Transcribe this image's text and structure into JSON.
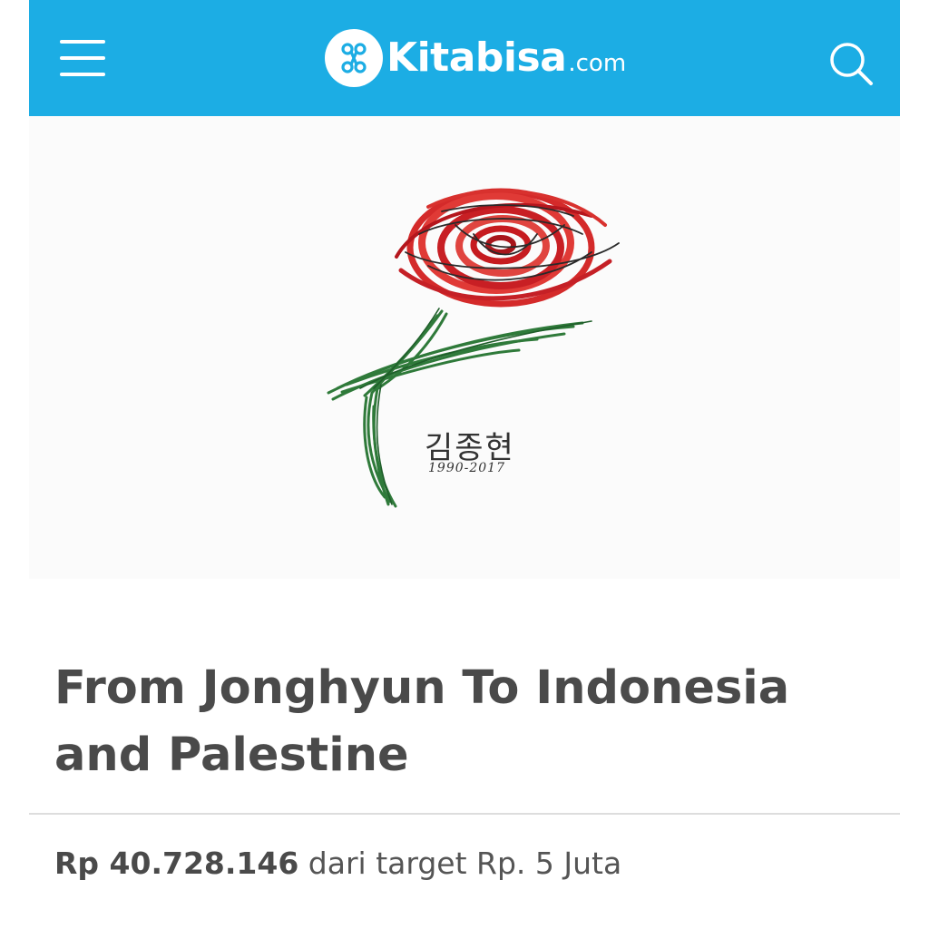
{
  "header": {
    "brand_name": "Kitabisa",
    "brand_tld": ".com",
    "menu_icon": "hamburger-menu-icon",
    "search_icon": "search-icon",
    "logo_icon": "kitabisa-logo-icon",
    "background_color": "#1cade4"
  },
  "campaign": {
    "image": {
      "subject": "red rose illustration",
      "name_text": "김종현",
      "years_text": "1990-2017"
    },
    "title": "From Jonghyun To Indonesia and Palestine",
    "amount": "Rp 40.728.146",
    "target_text": "dari target Rp. 5 Juta"
  }
}
